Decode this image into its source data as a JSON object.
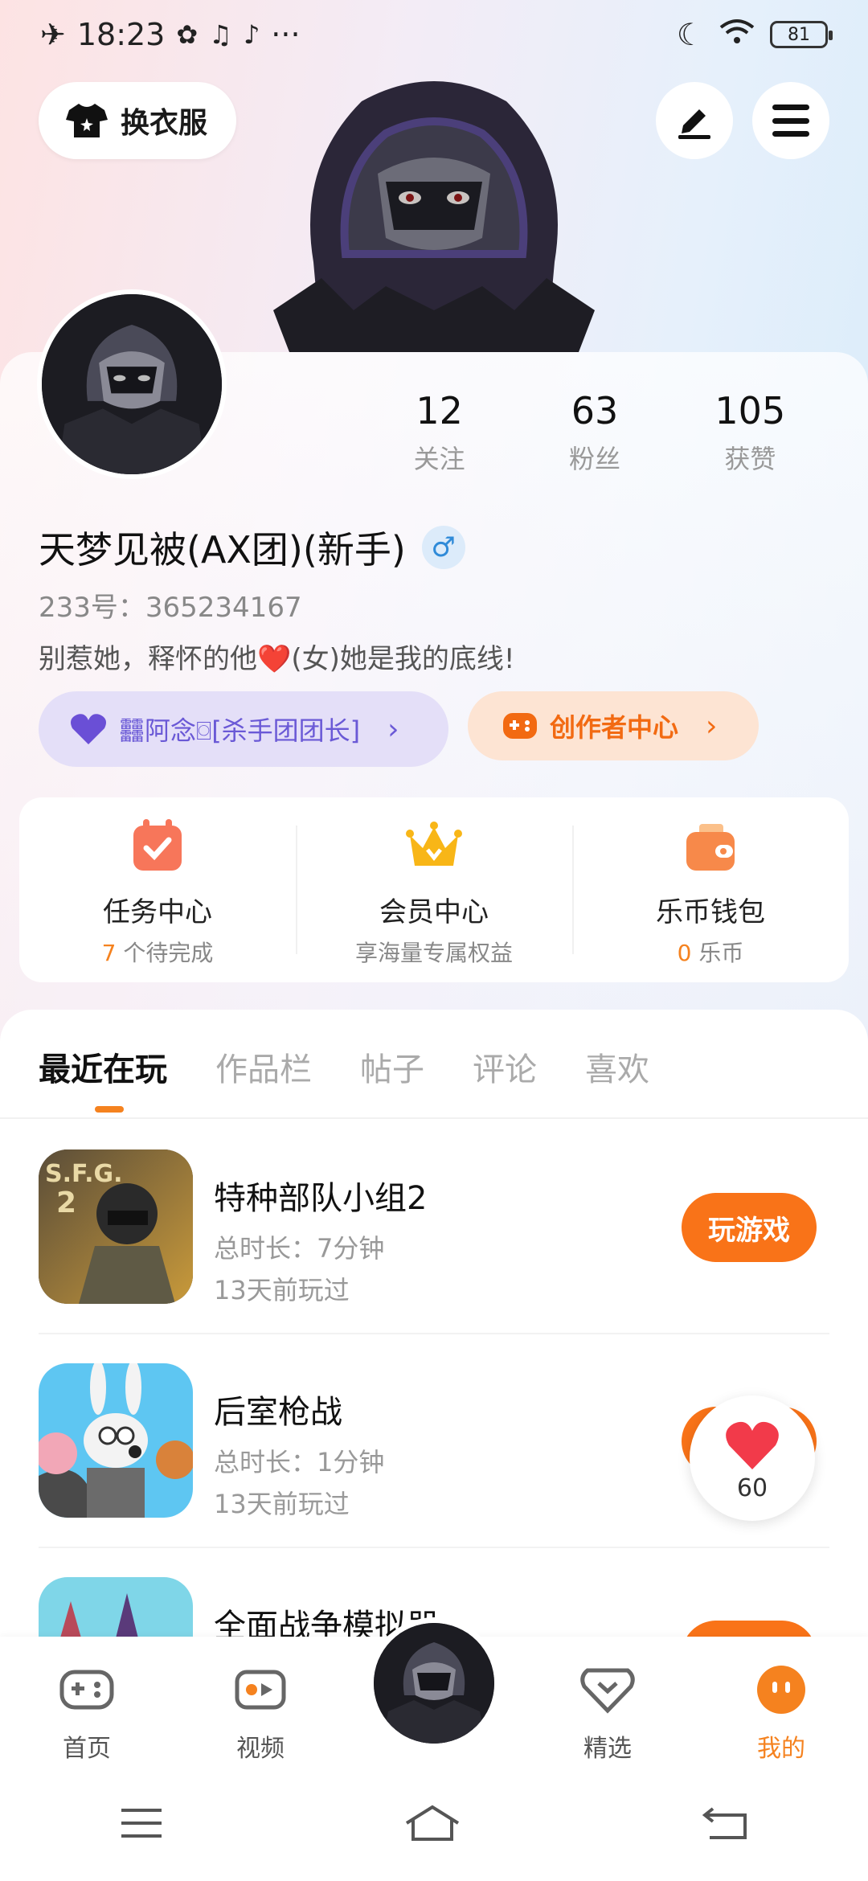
{
  "status_bar": {
    "time": "18:23",
    "battery": "81"
  },
  "header": {
    "outfit_label": "换衣服"
  },
  "profile": {
    "stats": [
      {
        "value": "12",
        "label": "关注"
      },
      {
        "value": "63",
        "label": "粉丝"
      },
      {
        "value": "105",
        "label": "获赞"
      }
    ],
    "nickname": "天梦见被(AX团)(新手)",
    "gender_symbol": "♂",
    "uid": "233号：365234167",
    "bio": "别惹她，释怀的他❤️(女)她是我的底线!",
    "team_tag": "䨻阿念⌼[杀手团团长]",
    "creator_tag": "创作者中心"
  },
  "services": [
    {
      "title": "任务中心",
      "count": "7",
      "suffix": " 个待完成"
    },
    {
      "title": "会员中心",
      "subtitle": "享海量专属权益"
    },
    {
      "title": "乐币钱包",
      "count": "0",
      "suffix": " 乐币"
    }
  ],
  "tabs": [
    "最近在玩",
    "作品栏",
    "帖子",
    "评论",
    "喜欢"
  ],
  "games": [
    {
      "name": "特种部队小组2",
      "duration": "总时长：7分钟",
      "last_played": "13天前玩过",
      "button": "玩游戏"
    },
    {
      "name": "后室枪战",
      "duration": "总时长：1分钟",
      "last_played": "13天前玩过",
      "button": "玩游戏"
    },
    {
      "name": "全面战争模拟器",
      "duration": "",
      "last_played": "",
      "button": "玩游戏"
    }
  ],
  "like_bubble": {
    "count": "60"
  },
  "bottom_nav": [
    {
      "label": "首页"
    },
    {
      "label": "视频"
    },
    {
      "label": "精选"
    },
    {
      "label": "我的"
    }
  ],
  "colors": {
    "accent": "#f97318",
    "team_tag_bg": "#e4dff8",
    "creator_tag_bg": "#fde4d3"
  }
}
